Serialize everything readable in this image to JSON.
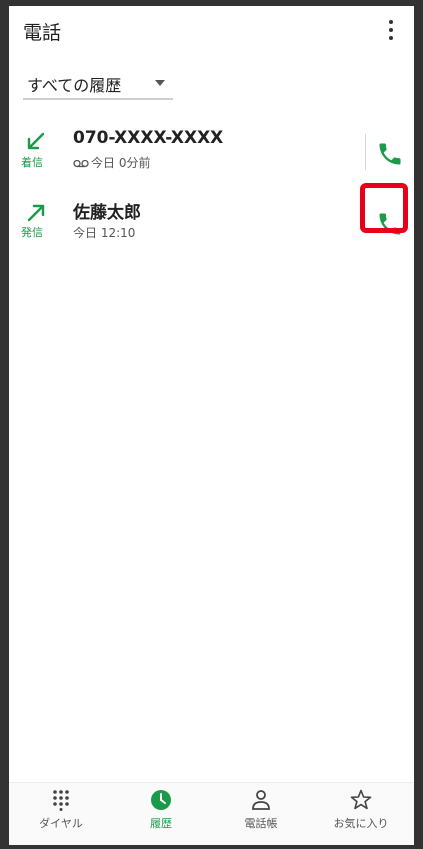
{
  "app": {
    "title": "電話"
  },
  "filter": {
    "label": "すべての履歴"
  },
  "history": [
    {
      "name": "070-XXXX-XXXX",
      "direction": "着信",
      "meta": "今日 0分前",
      "has_voicemail_icon": true
    },
    {
      "name": "佐藤太郎",
      "direction": "発信",
      "meta": "今日 12:10",
      "has_voicemail_icon": false
    }
  ],
  "bottom_nav": [
    {
      "label": "ダイヤル",
      "icon": "dialpad-icon",
      "active": false
    },
    {
      "label": "履歴",
      "icon": "clock-icon",
      "active": true
    },
    {
      "label": "電話帳",
      "icon": "person-icon",
      "active": false
    },
    {
      "label": "お気に入り",
      "icon": "star-icon",
      "active": false
    }
  ],
  "colors": {
    "accent": "#1a9a4a",
    "highlight": "#e8001b",
    "frame": "#333333"
  }
}
